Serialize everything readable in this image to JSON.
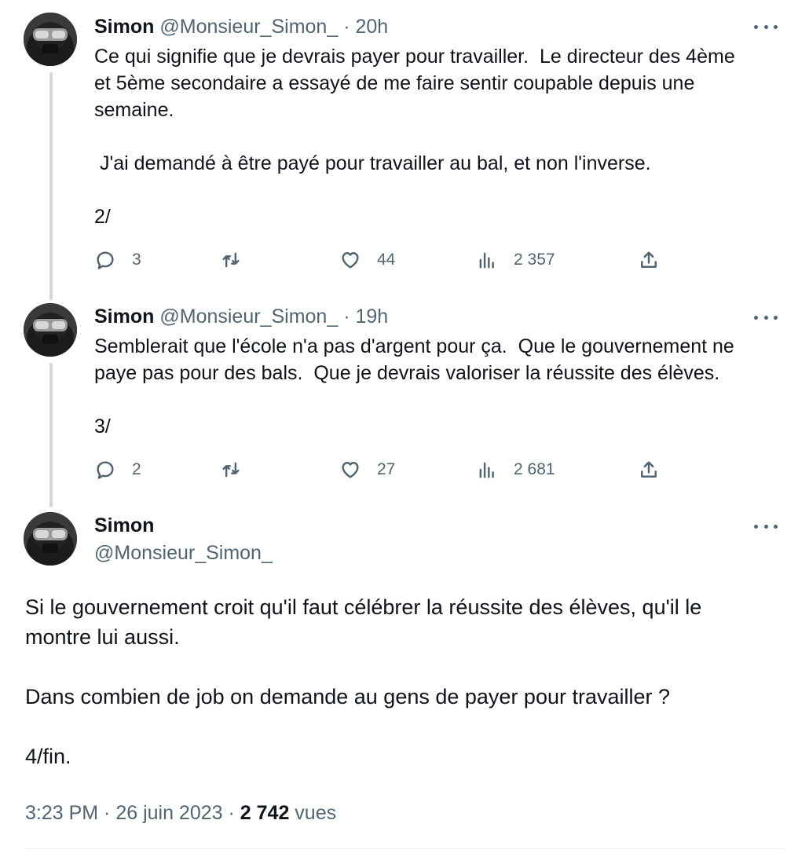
{
  "tweets": [
    {
      "name": "Simon",
      "handle": "@Monsieur_Simon_",
      "dot": "·",
      "time": "20h",
      "text": "Ce qui signifie que je devrais payer pour travailler.  Le directeur des 4ème\net 5ème secondaire a essayé de me faire sentir coupable depuis une\nsemaine.\n\n J'ai demandé à être payé pour travailler au bal, et non l'inverse.\n\n2/",
      "replies": "3",
      "retweets": "",
      "likes": "44",
      "views": "2 357"
    },
    {
      "name": "Simon",
      "handle": "@Monsieur_Simon_",
      "dot": "·",
      "time": "19h",
      "text": "Semblerait que l'école n'a pas d'argent pour ça.  Que le gouvernement ne\npaye pas pour des bals.  Que je devrais valoriser la réussite des élèves.\n\n3/",
      "replies": "2",
      "retweets": "",
      "likes": "27",
      "views": "2 681"
    }
  ],
  "main": {
    "name": "Simon",
    "handle": "@Monsieur_Simon_",
    "text": "Si le gouvernement croit qu'il faut célébrer la réussite des élèves, qu'il le\nmontre lui aussi.\n\nDans combien de job on demande au gens de payer pour travailler ?\n\n4/fin.",
    "timestamp": "3:23 PM · 26 juin 2023 · ",
    "views_count": "2 742",
    "views_label": " vues"
  },
  "icons": {
    "reply": "reply-icon",
    "retweet": "retweet-icon",
    "like": "heart-icon",
    "views": "views-icon",
    "share": "share-icon",
    "more": "more-icon"
  },
  "colors": {
    "text": "#0f1419",
    "secondary": "#536471",
    "thread_line": "#cfd9de"
  }
}
